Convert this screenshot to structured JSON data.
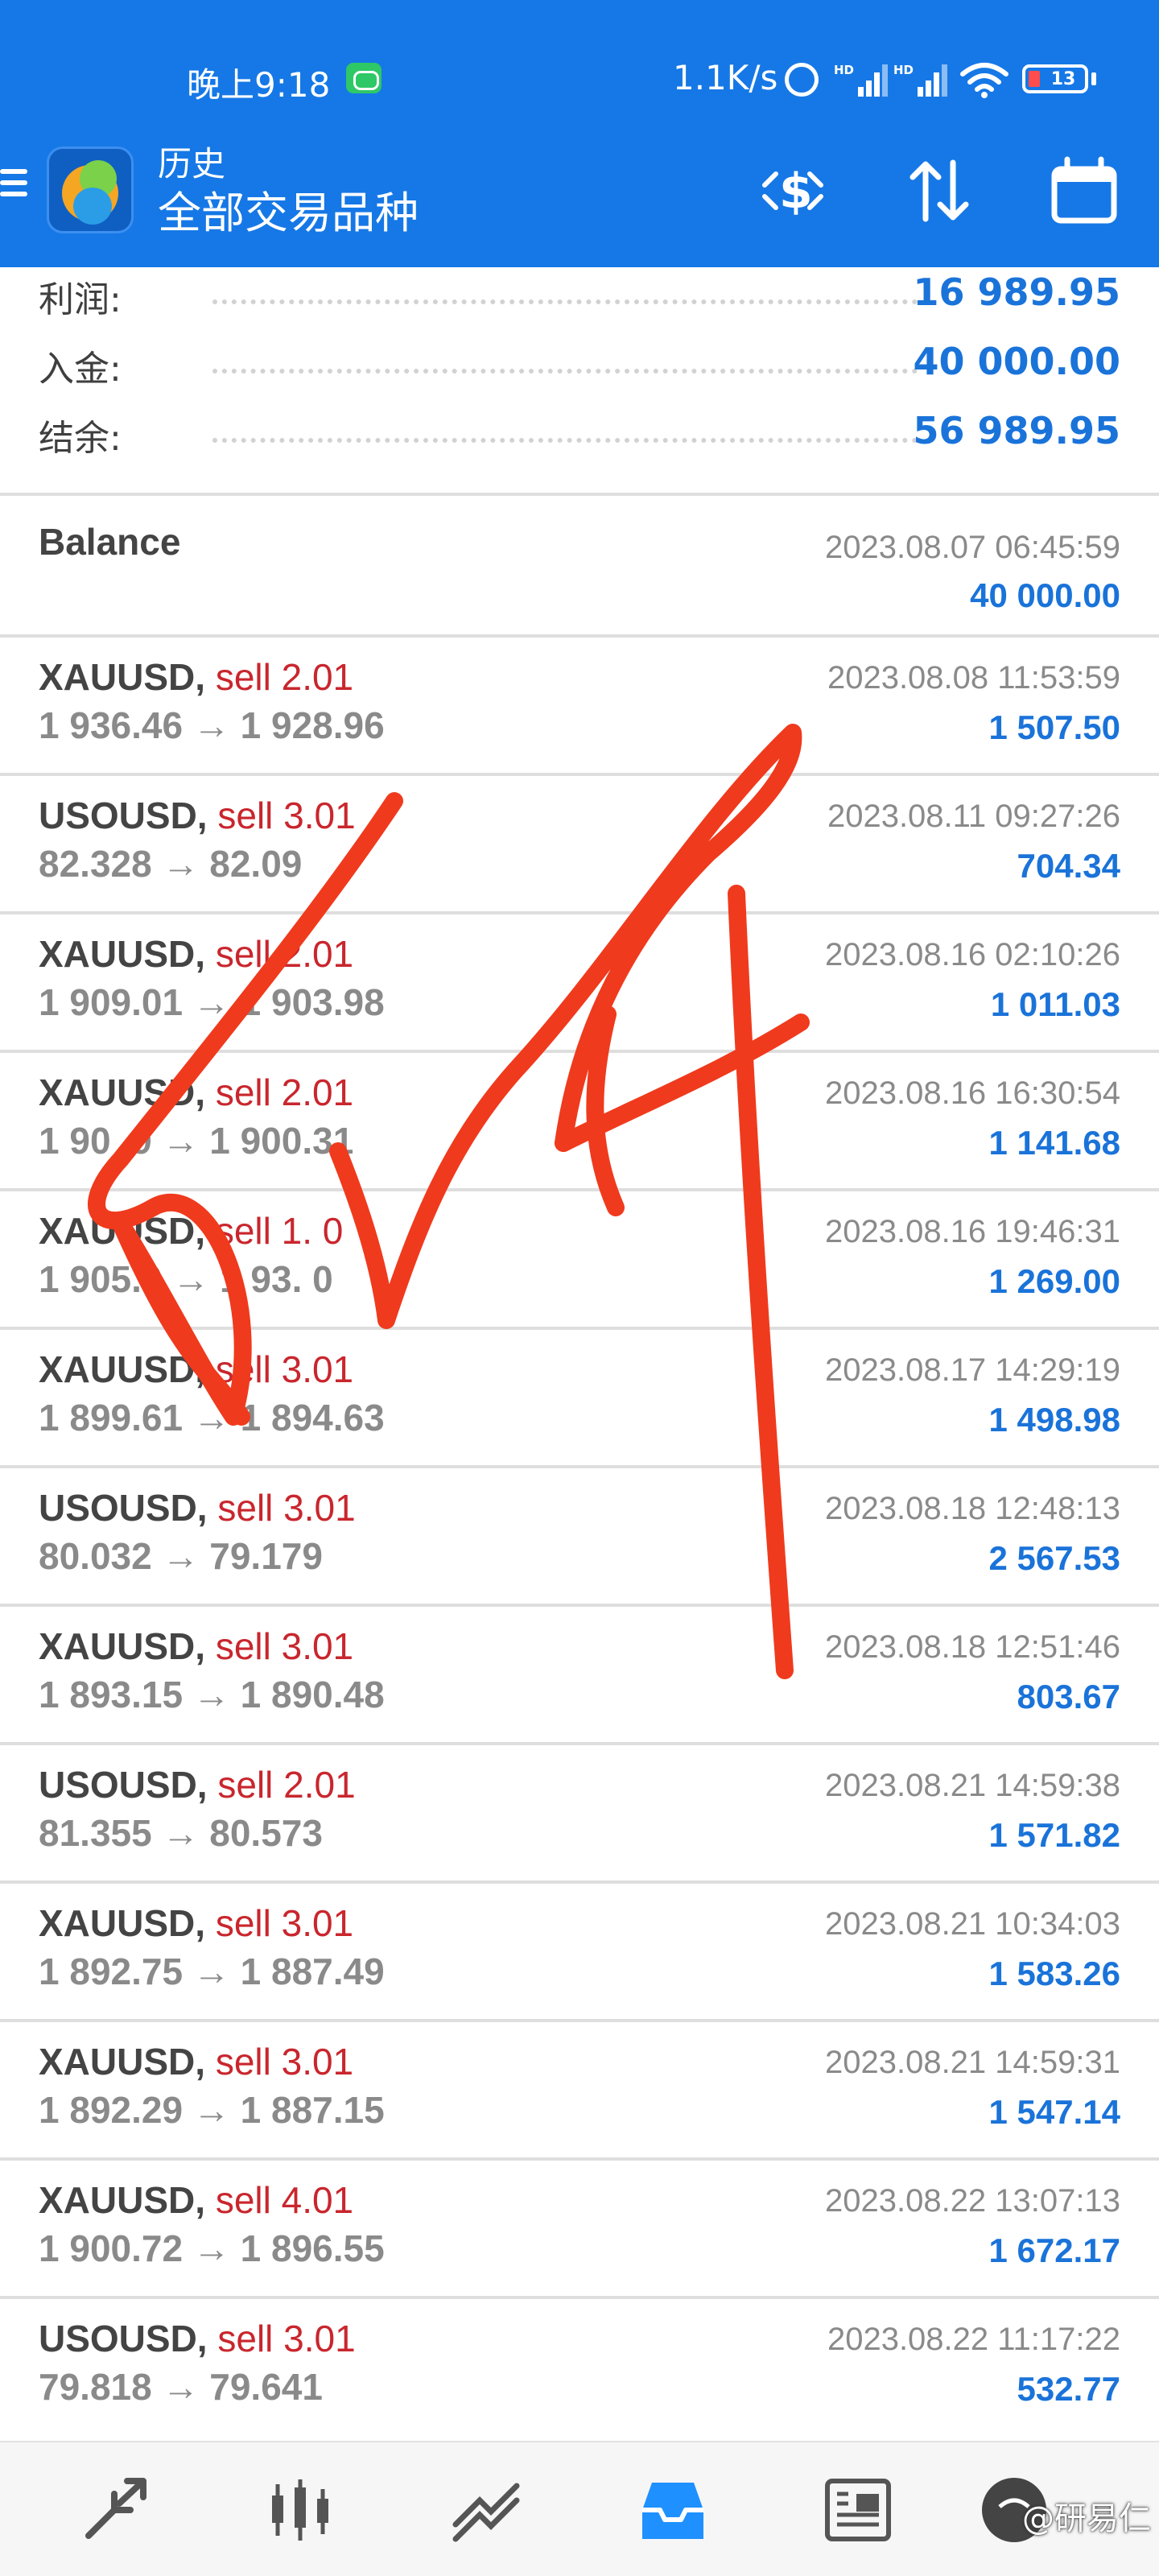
{
  "status_bar": {
    "time": "晚上9:18",
    "net_speed": "1.1K/s",
    "signal_label": "HD",
    "battery": "13"
  },
  "app_bar": {
    "title": "历史",
    "subtitle": "全部交易品种"
  },
  "summary": [
    {
      "label": "利润:",
      "value": "16 989.95"
    },
    {
      "label": "入金:",
      "value": "40 000.00"
    },
    {
      "label": "结余:",
      "value": "56 989.95"
    }
  ],
  "balance_entry": {
    "label": "Balance",
    "date": "2023.08.07 06:45:59",
    "amount": "40 000.00"
  },
  "deals": [
    {
      "symbol": "XAUUSD,",
      "side": "sell 2.01",
      "prices": "1 936.46 → 1 928.96",
      "date": "2023.08.08 11:53:59",
      "profit": "1 507.50"
    },
    {
      "symbol": "USOUSD,",
      "side": "sell 3.01",
      "prices": "82.328 → 82.09",
      "date": "2023.08.11 09:27:26",
      "profit": "704.34"
    },
    {
      "symbol": "XAUUSD,",
      "side": "sell 2.01",
      "prices": "1 909.01 → 1 903.98",
      "date": "2023.08.16 02:10:26",
      "profit": "1 011.03"
    },
    {
      "symbol": "XAUUSD,",
      "side": "sell 2.01",
      "prices": "1 90 .9 → 1 900.31",
      "date": "2023.08.16 16:30:54",
      "profit": "1 141.68"
    },
    {
      "symbol": "XAUUSD,",
      "side": "sell 1. 0",
      "prices": "1 905.9 → 1 93. 0",
      "date": "2023.08.16 19:46:31",
      "profit": "1 269.00"
    },
    {
      "symbol": "XAUUSD,",
      "side": "sell 3.01",
      "prices": "1 899.61 → 1 894.63",
      "date": "2023.08.17 14:29:19",
      "profit": "1 498.98"
    },
    {
      "symbol": "USOUSD,",
      "side": "sell 3.01",
      "prices": "80.032 → 79.179",
      "date": "2023.08.18 12:48:13",
      "profit": "2 567.53"
    },
    {
      "symbol": "XAUUSD,",
      "side": "sell 3.01",
      "prices": "1 893.15 → 1 890.48",
      "date": "2023.08.18 12:51:46",
      "profit": "803.67"
    },
    {
      "symbol": "USOUSD,",
      "side": "sell 2.01",
      "prices": "81.355 → 80.573",
      "date": "2023.08.21 14:59:38",
      "profit": "1 571.82"
    },
    {
      "symbol": "XAUUSD,",
      "side": "sell 3.01",
      "prices": "1 892.75 → 1 887.49",
      "date": "2023.08.21 10:34:03",
      "profit": "1 583.26"
    },
    {
      "symbol": "XAUUSD,",
      "side": "sell 3.01",
      "prices": "1 892.29 → 1 887.15",
      "date": "2023.08.21 14:59:31",
      "profit": "1 547.14"
    },
    {
      "symbol": "XAUUSD,",
      "side": "sell 4.01",
      "prices": "1 900.72 → 1 896.55",
      "date": "2023.08.22 13:07:13",
      "profit": "1 672.17"
    },
    {
      "symbol": "USOUSD,",
      "side": "sell 3.01",
      "prices": "79.818 → 79.641",
      "date": "2023.08.22 11:17:22",
      "profit": "532.77"
    }
  ],
  "bottom_nav": {
    "items": [
      "quotes-icon",
      "chart-icon",
      "trade-icon",
      "history-icon",
      "news-icon",
      "messages-icon"
    ],
    "active": "history-icon"
  },
  "watermark": "@研易仁",
  "colors": {
    "brand": "#1678e6",
    "profit": "#1a73d9",
    "sell": "#c9262d",
    "scribble": "#f03a1d"
  }
}
